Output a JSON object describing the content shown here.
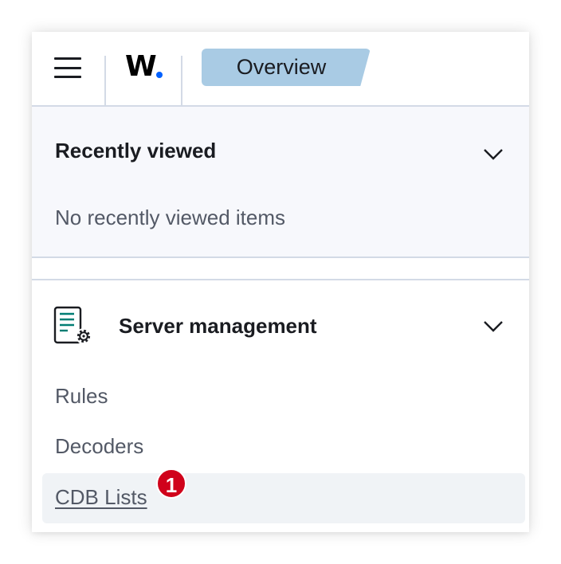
{
  "header": {
    "menu_icon": "hamburger-menu-icon",
    "logo_text": "W",
    "logo_dot_color": "#0061ff",
    "breadcrumb_label": "Overview",
    "breadcrumb_color": "#a9cbe4"
  },
  "recently_viewed": {
    "title": "Recently viewed",
    "empty_text": "No recently viewed items",
    "chevron_icon": "chevron-down-icon"
  },
  "server_management": {
    "icon": "document-gear-icon",
    "title": "Server management",
    "chevron_icon": "chevron-down-icon",
    "items": [
      {
        "label": "Rules"
      },
      {
        "label": "Decoders"
      },
      {
        "label": "CDB Lists",
        "active": true
      }
    ]
  },
  "annotation": {
    "badge_text": "1",
    "badge_color": "#d0021b"
  }
}
